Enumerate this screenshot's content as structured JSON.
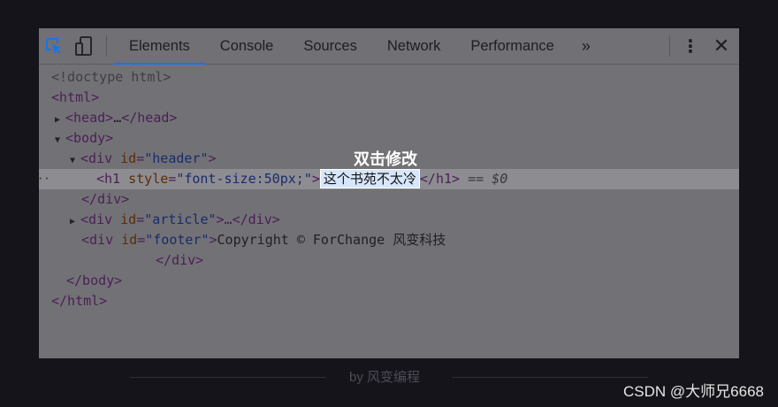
{
  "toolbar": {
    "inspect_icon": "element-picker-icon",
    "device_icon": "device-toggle-icon",
    "tabs": [
      "Elements",
      "Console",
      "Sources",
      "Network",
      "Performance"
    ],
    "active_tab": "Elements",
    "more_tabs": "»",
    "menu_icon": "⋮",
    "close_icon": "✕"
  },
  "tree": {
    "l1": "<!doctype html>",
    "l2": "<html>",
    "l3a": "<head>",
    "l3b": "…",
    "l3c": "</head>",
    "l4": "<body>",
    "l5_tag": "<div",
    "l5_attr": "id",
    "l5_val": "\"header\"",
    "l5_close": ">",
    "l6_tag": "<h1",
    "l6_attr": "style",
    "l6_val": "\"font-size:50px;\"",
    "l6_close": ">",
    "l6_edit": "这个书苑不太冷",
    "l6_end": "</h1>",
    "l6_eq": "== $0",
    "l7": "</div>",
    "l8_tag": "<div",
    "l8_attr": "id",
    "l8_val": "\"article\"",
    "l8_rest": ">…</div>",
    "l9_tag": "<div",
    "l9_attr": "id",
    "l9_val": "\"footer\"",
    "l9_close": ">",
    "l9_text": "Copyright © ForChange 风变科技",
    "l10": "</div>",
    "l11": "</body>",
    "l12": "</html>"
  },
  "tooltip": "双击修改",
  "footer": "by 风变编程",
  "watermark": "CSDN @大师兄6668"
}
